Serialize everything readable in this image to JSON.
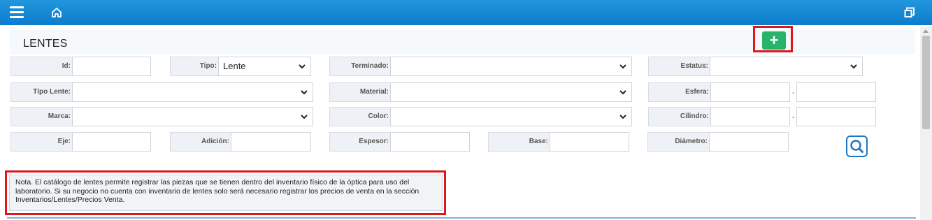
{
  "icons": {
    "menu": "hamburger-menu-icon",
    "home": "home-icon",
    "window": "restore-window-icon",
    "add": "plus-icon",
    "search": "magnifier-icon"
  },
  "colors": {
    "topbar": "#1485d4",
    "add_button": "#27b36a",
    "highlight": "#e0161d",
    "search": "#1f78c2"
  },
  "page": {
    "title": "LENTES",
    "add_label": "+"
  },
  "filters": {
    "id": {
      "label": "Id:",
      "value": ""
    },
    "tipo": {
      "label": "Tipo:",
      "value": "Lente"
    },
    "terminado": {
      "label": "Terminado:",
      "value": ""
    },
    "estatus": {
      "label": "Estatus:",
      "value": ""
    },
    "tipo_lente": {
      "label": "Tipo Lente:",
      "value": ""
    },
    "material": {
      "label": "Material:",
      "value": ""
    },
    "esfera": {
      "label": "Esfera:",
      "from": "",
      "separator": "-",
      "to": ""
    },
    "marca": {
      "label": "Marca:",
      "value": ""
    },
    "color": {
      "label": "Color:",
      "value": ""
    },
    "cilindro": {
      "label": "Cilindro:",
      "from": "",
      "separator": "-",
      "to": ""
    },
    "eje": {
      "label": "Eje:",
      "value": ""
    },
    "adicion": {
      "label": "Adición:",
      "value": ""
    },
    "espesor": {
      "label": "Espesor:",
      "value": ""
    },
    "base": {
      "label": "Base:",
      "value": ""
    },
    "diametro": {
      "label": "Diámetro:",
      "value": ""
    }
  },
  "note": {
    "line1": "Nota. El catálogo de lentes permite registrar las piezas que se tienen dentro del inventario físico de la óptica para uso del",
    "line2": "laboratorio. Si su negocio no cuenta con inventario de lentes solo será necesario registrar los precios de venta en la sección",
    "line3": "Inventarios/Lentes/Precios Venta."
  }
}
